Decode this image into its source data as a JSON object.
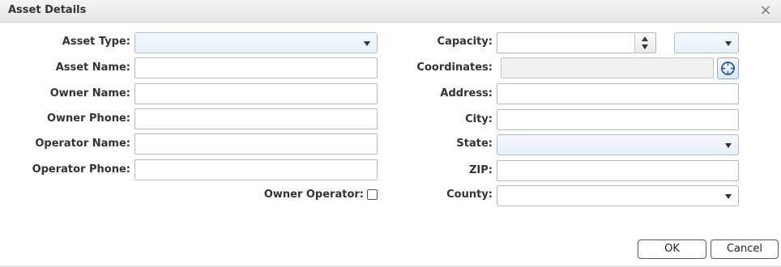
{
  "dialog": {
    "title": "Asset Details",
    "close_glyph": "×"
  },
  "left": {
    "asset_type_label": "Asset Type:",
    "asset_type_value": "",
    "asset_name_label": "Asset Name:",
    "asset_name_value": "",
    "owner_name_label": "Owner Name:",
    "owner_name_value": "",
    "owner_phone_label": "Owner Phone:",
    "owner_phone_value": "",
    "operator_name_label": "Operator Name:",
    "operator_name_value": "",
    "operator_phone_label": "Operator Phone:",
    "operator_phone_value": "",
    "owner_operator_label": "Owner Operator:",
    "owner_operator_checked": false
  },
  "right": {
    "capacity_label": "Capacity:",
    "capacity_value": "",
    "capacity_unit_value": "",
    "coordinates_label": "Coordinates:",
    "coordinates_value": "",
    "address_label": "Address:",
    "address_value": "",
    "city_label": "City:",
    "city_value": "",
    "state_label": "State:",
    "state_value": "",
    "zip_label": "ZIP:",
    "zip_value": "",
    "county_label": "County:",
    "county_value": ""
  },
  "footer": {
    "ok_label": "OK",
    "cancel_label": "Cancel"
  },
  "icons": {
    "close": "close-icon",
    "dropdown": "chevron-down-icon",
    "spinner_up": "spinner-up-icon",
    "spinner_down": "spinner-down-icon",
    "location_picker": "crosshair-icon"
  },
  "colors": {
    "titlebar": "#e9e9e9",
    "select_border": "#a8bcd6",
    "picker_accent": "#2a5aa0"
  }
}
